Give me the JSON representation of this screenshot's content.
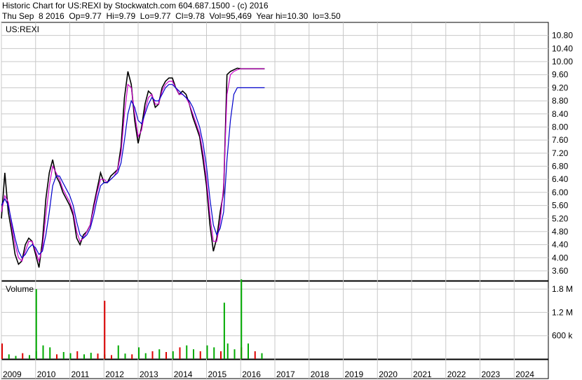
{
  "header": {
    "line1": "Historic Chart for US:REXI by Stockwatch.com 604.687.1500 - (c) 2016",
    "line2": "Thu Sep  8 2016  Op=9.77  Hi=9.79  Lo=9.77  Cl=9.78  Vol=95,469  Year hi=10.30  lo=3.50"
  },
  "colors": {
    "price": "#000000",
    "ma_short": "#cc00cc",
    "ma_long": "#0000cc",
    "vol_up": "#00aa00",
    "vol_down": "#dd0000",
    "grid": "#c8c8c8"
  },
  "chart_data": [
    {
      "type": "line",
      "title": "US:REXI",
      "ylim": [
        3.3,
        11.2
      ],
      "y_ticks": [
        "10.80",
        "10.40",
        "10.00",
        "9.60",
        "9.20",
        "8.80",
        "8.40",
        "8.00",
        "7.60",
        "7.20",
        "6.80",
        "6.40",
        "6.00",
        "5.60",
        "5.20",
        "4.80",
        "4.40",
        "4.00",
        "3.60"
      ],
      "x": [
        2009.0,
        2009.1,
        2009.2,
        2009.3,
        2009.4,
        2009.5,
        2009.6,
        2009.7,
        2009.8,
        2009.9,
        2010.0,
        2010.1,
        2010.2,
        2010.3,
        2010.4,
        2010.5,
        2010.6,
        2010.7,
        2010.8,
        2010.9,
        2011.0,
        2011.1,
        2011.2,
        2011.3,
        2011.4,
        2011.5,
        2011.6,
        2011.7,
        2011.8,
        2011.9,
        2012.0,
        2012.1,
        2012.2,
        2012.3,
        2012.4,
        2012.5,
        2012.6,
        2012.7,
        2012.8,
        2012.9,
        2013.0,
        2013.1,
        2013.2,
        2013.3,
        2013.4,
        2013.5,
        2013.6,
        2013.7,
        2013.8,
        2013.9,
        2014.0,
        2014.1,
        2014.2,
        2014.3,
        2014.4,
        2014.5,
        2014.6,
        2014.7,
        2014.8,
        2014.9,
        2015.0,
        2015.1,
        2015.2,
        2015.3,
        2015.4,
        2015.5,
        2015.6,
        2015.7,
        2015.8,
        2015.9,
        2016.0,
        2016.1,
        2016.2,
        2016.3,
        2016.4,
        2016.5,
        2016.6,
        2016.7
      ],
      "series": [
        {
          "key": "close",
          "values": [
            5.2,
            6.6,
            5.4,
            4.8,
            4.1,
            3.8,
            3.9,
            4.4,
            4.6,
            4.5,
            4.1,
            3.7,
            4.5,
            5.8,
            6.6,
            7.0,
            6.5,
            6.3,
            6.0,
            5.8,
            5.6,
            5.3,
            4.6,
            4.4,
            4.7,
            4.8,
            5.0,
            5.6,
            6.1,
            6.6,
            6.3,
            6.3,
            6.5,
            6.6,
            6.7,
            7.4,
            8.9,
            9.7,
            9.3,
            8.2,
            7.5,
            8.0,
            8.7,
            9.1,
            9.0,
            8.6,
            8.7,
            9.2,
            9.4,
            9.5,
            9.5,
            9.2,
            9.0,
            9.1,
            9.0,
            8.7,
            8.3,
            8.0,
            7.7,
            7.0,
            6.2,
            5.0,
            4.2,
            4.6,
            5.4,
            6.0,
            9.6,
            9.7,
            9.75,
            9.8,
            9.78,
            9.78,
            9.78,
            9.78,
            9.78,
            9.78,
            9.78,
            9.78
          ]
        },
        {
          "key": "ma_short",
          "values": [
            5.4,
            5.9,
            5.7,
            5.0,
            4.4,
            4.0,
            3.9,
            4.2,
            4.5,
            4.5,
            4.2,
            3.9,
            4.3,
            5.3,
            6.2,
            6.8,
            6.6,
            6.4,
            6.1,
            5.9,
            5.7,
            5.4,
            4.8,
            4.5,
            4.6,
            4.8,
            5.0,
            5.5,
            6.0,
            6.4,
            6.4,
            6.3,
            6.4,
            6.5,
            6.7,
            7.2,
            8.4,
            9.3,
            9.2,
            8.4,
            7.7,
            7.9,
            8.5,
            8.9,
            9.0,
            8.7,
            8.7,
            9.1,
            9.3,
            9.4,
            9.4,
            9.2,
            9.0,
            9.0,
            8.9,
            8.7,
            8.4,
            8.1,
            7.8,
            7.2,
            6.4,
            5.3,
            4.5,
            4.5,
            5.1,
            6.2,
            9.0,
            9.6,
            9.7,
            9.75,
            9.78,
            9.78,
            9.78,
            9.78,
            9.78,
            9.78,
            9.78,
            9.78
          ]
        },
        {
          "key": "ma_long",
          "values": [
            5.6,
            5.8,
            5.6,
            5.1,
            4.6,
            4.2,
            4.0,
            4.1,
            4.3,
            4.4,
            4.3,
            4.1,
            4.2,
            4.7,
            5.4,
            6.2,
            6.5,
            6.5,
            6.3,
            6.1,
            5.9,
            5.6,
            5.1,
            4.7,
            4.6,
            4.7,
            4.9,
            5.3,
            5.8,
            6.2,
            6.3,
            6.3,
            6.4,
            6.5,
            6.6,
            6.9,
            7.6,
            8.4,
            8.8,
            8.6,
            8.2,
            8.1,
            8.4,
            8.7,
            8.9,
            8.8,
            8.8,
            9.0,
            9.2,
            9.3,
            9.3,
            9.2,
            9.1,
            9.0,
            8.9,
            8.8,
            8.6,
            8.3,
            8.0,
            7.5,
            6.8,
            5.8,
            5.0,
            4.7,
            4.9,
            5.4,
            7.0,
            8.2,
            9.0,
            9.2,
            9.2,
            9.2,
            9.2,
            9.2,
            9.2,
            9.2,
            9.2,
            9.2
          ]
        }
      ]
    },
    {
      "type": "bar",
      "title": "Volume",
      "ylim": [
        0,
        2000000
      ],
      "y_ticks": [
        "1.8 M",
        "1.2 M",
        "600 k"
      ],
      "x_ticks": [
        "2009",
        "2010",
        "2011",
        "2012",
        "2013",
        "2014",
        "2015",
        "2016",
        "2017",
        "2018",
        "2019",
        "2020",
        "2021",
        "2022",
        "2023",
        "2024"
      ],
      "x": [
        2009.0,
        2009.2,
        2009.4,
        2009.6,
        2009.8,
        2010.0,
        2010.2,
        2010.4,
        2010.6,
        2010.8,
        2011.0,
        2011.2,
        2011.4,
        2011.6,
        2011.8,
        2012.0,
        2012.2,
        2012.4,
        2012.6,
        2012.8,
        2013.0,
        2013.2,
        2013.4,
        2013.6,
        2013.8,
        2014.0,
        2014.2,
        2014.4,
        2014.6,
        2014.8,
        2015.0,
        2015.2,
        2015.4,
        2015.6,
        2015.8,
        2016.0,
        2016.2,
        2016.4,
        2016.6,
        2015.5,
        2016.0,
        2010.0,
        2012.0
      ],
      "values": [
        400000,
        120000,
        80000,
        150000,
        100000,
        200000,
        350000,
        300000,
        120000,
        180000,
        150000,
        200000,
        120000,
        160000,
        140000,
        120000,
        100000,
        350000,
        140000,
        120000,
        300000,
        150000,
        200000,
        250000,
        180000,
        200000,
        300000,
        350000,
        250000,
        200000,
        350000,
        300000,
        200000,
        400000,
        250000,
        300000,
        400000,
        200000,
        150000,
        1450000,
        2050000,
        1800000,
        1500000
      ],
      "up": [
        false,
        true,
        true,
        false,
        true,
        true,
        true,
        true,
        false,
        true,
        true,
        false,
        true,
        true,
        false,
        true,
        false,
        true,
        true,
        false,
        true,
        true,
        false,
        true,
        false,
        true,
        false,
        true,
        true,
        false,
        true,
        true,
        false,
        true,
        true,
        false,
        true,
        false,
        true,
        true,
        true,
        true,
        false
      ]
    }
  ]
}
